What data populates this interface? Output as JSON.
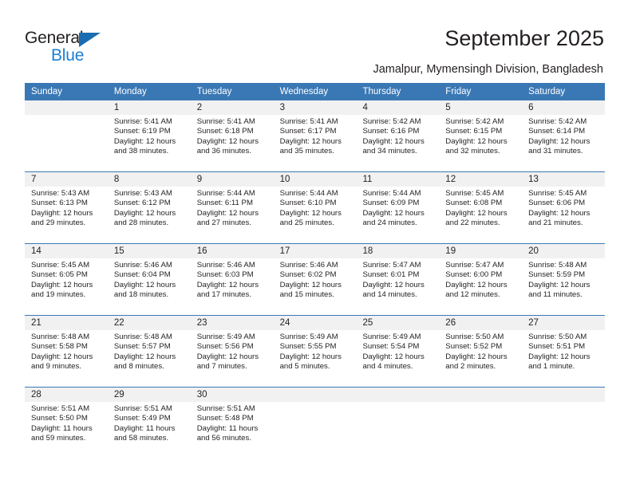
{
  "brand": {
    "name_part1": "General",
    "name_part2": "Blue",
    "triangle_icon": "triangle-icon",
    "accent_color": "#1b7fd4"
  },
  "header": {
    "month_title": "September 2025",
    "location": "Jamalpur, Mymensingh Division, Bangladesh"
  },
  "theme": {
    "header_blue": "#3a78b5",
    "daynum_gray": "#f1f1f1",
    "text_color": "#231f20"
  },
  "calendar": {
    "weekday_headers": [
      "Sunday",
      "Monday",
      "Tuesday",
      "Wednesday",
      "Thursday",
      "Friday",
      "Saturday"
    ],
    "weeks": [
      {
        "days": [
          {
            "num": "",
            "sunrise": "",
            "sunset": "",
            "daylight": ""
          },
          {
            "num": "1",
            "sunrise": "Sunrise: 5:41 AM",
            "sunset": "Sunset: 6:19 PM",
            "daylight": "Daylight: 12 hours and 38 minutes."
          },
          {
            "num": "2",
            "sunrise": "Sunrise: 5:41 AM",
            "sunset": "Sunset: 6:18 PM",
            "daylight": "Daylight: 12 hours and 36 minutes."
          },
          {
            "num": "3",
            "sunrise": "Sunrise: 5:41 AM",
            "sunset": "Sunset: 6:17 PM",
            "daylight": "Daylight: 12 hours and 35 minutes."
          },
          {
            "num": "4",
            "sunrise": "Sunrise: 5:42 AM",
            "sunset": "Sunset: 6:16 PM",
            "daylight": "Daylight: 12 hours and 34 minutes."
          },
          {
            "num": "5",
            "sunrise": "Sunrise: 5:42 AM",
            "sunset": "Sunset: 6:15 PM",
            "daylight": "Daylight: 12 hours and 32 minutes."
          },
          {
            "num": "6",
            "sunrise": "Sunrise: 5:42 AM",
            "sunset": "Sunset: 6:14 PM",
            "daylight": "Daylight: 12 hours and 31 minutes."
          }
        ]
      },
      {
        "days": [
          {
            "num": "7",
            "sunrise": "Sunrise: 5:43 AM",
            "sunset": "Sunset: 6:13 PM",
            "daylight": "Daylight: 12 hours and 29 minutes."
          },
          {
            "num": "8",
            "sunrise": "Sunrise: 5:43 AM",
            "sunset": "Sunset: 6:12 PM",
            "daylight": "Daylight: 12 hours and 28 minutes."
          },
          {
            "num": "9",
            "sunrise": "Sunrise: 5:44 AM",
            "sunset": "Sunset: 6:11 PM",
            "daylight": "Daylight: 12 hours and 27 minutes."
          },
          {
            "num": "10",
            "sunrise": "Sunrise: 5:44 AM",
            "sunset": "Sunset: 6:10 PM",
            "daylight": "Daylight: 12 hours and 25 minutes."
          },
          {
            "num": "11",
            "sunrise": "Sunrise: 5:44 AM",
            "sunset": "Sunset: 6:09 PM",
            "daylight": "Daylight: 12 hours and 24 minutes."
          },
          {
            "num": "12",
            "sunrise": "Sunrise: 5:45 AM",
            "sunset": "Sunset: 6:08 PM",
            "daylight": "Daylight: 12 hours and 22 minutes."
          },
          {
            "num": "13",
            "sunrise": "Sunrise: 5:45 AM",
            "sunset": "Sunset: 6:06 PM",
            "daylight": "Daylight: 12 hours and 21 minutes."
          }
        ]
      },
      {
        "days": [
          {
            "num": "14",
            "sunrise": "Sunrise: 5:45 AM",
            "sunset": "Sunset: 6:05 PM",
            "daylight": "Daylight: 12 hours and 19 minutes."
          },
          {
            "num": "15",
            "sunrise": "Sunrise: 5:46 AM",
            "sunset": "Sunset: 6:04 PM",
            "daylight": "Daylight: 12 hours and 18 minutes."
          },
          {
            "num": "16",
            "sunrise": "Sunrise: 5:46 AM",
            "sunset": "Sunset: 6:03 PM",
            "daylight": "Daylight: 12 hours and 17 minutes."
          },
          {
            "num": "17",
            "sunrise": "Sunrise: 5:46 AM",
            "sunset": "Sunset: 6:02 PM",
            "daylight": "Daylight: 12 hours and 15 minutes."
          },
          {
            "num": "18",
            "sunrise": "Sunrise: 5:47 AM",
            "sunset": "Sunset: 6:01 PM",
            "daylight": "Daylight: 12 hours and 14 minutes."
          },
          {
            "num": "19",
            "sunrise": "Sunrise: 5:47 AM",
            "sunset": "Sunset: 6:00 PM",
            "daylight": "Daylight: 12 hours and 12 minutes."
          },
          {
            "num": "20",
            "sunrise": "Sunrise: 5:48 AM",
            "sunset": "Sunset: 5:59 PM",
            "daylight": "Daylight: 12 hours and 11 minutes."
          }
        ]
      },
      {
        "days": [
          {
            "num": "21",
            "sunrise": "Sunrise: 5:48 AM",
            "sunset": "Sunset: 5:58 PM",
            "daylight": "Daylight: 12 hours and 9 minutes."
          },
          {
            "num": "22",
            "sunrise": "Sunrise: 5:48 AM",
            "sunset": "Sunset: 5:57 PM",
            "daylight": "Daylight: 12 hours and 8 minutes."
          },
          {
            "num": "23",
            "sunrise": "Sunrise: 5:49 AM",
            "sunset": "Sunset: 5:56 PM",
            "daylight": "Daylight: 12 hours and 7 minutes."
          },
          {
            "num": "24",
            "sunrise": "Sunrise: 5:49 AM",
            "sunset": "Sunset: 5:55 PM",
            "daylight": "Daylight: 12 hours and 5 minutes."
          },
          {
            "num": "25",
            "sunrise": "Sunrise: 5:49 AM",
            "sunset": "Sunset: 5:54 PM",
            "daylight": "Daylight: 12 hours and 4 minutes."
          },
          {
            "num": "26",
            "sunrise": "Sunrise: 5:50 AM",
            "sunset": "Sunset: 5:52 PM",
            "daylight": "Daylight: 12 hours and 2 minutes."
          },
          {
            "num": "27",
            "sunrise": "Sunrise: 5:50 AM",
            "sunset": "Sunset: 5:51 PM",
            "daylight": "Daylight: 12 hours and 1 minute."
          }
        ]
      },
      {
        "days": [
          {
            "num": "28",
            "sunrise": "Sunrise: 5:51 AM",
            "sunset": "Sunset: 5:50 PM",
            "daylight": "Daylight: 11 hours and 59 minutes."
          },
          {
            "num": "29",
            "sunrise": "Sunrise: 5:51 AM",
            "sunset": "Sunset: 5:49 PM",
            "daylight": "Daylight: 11 hours and 58 minutes."
          },
          {
            "num": "30",
            "sunrise": "Sunrise: 5:51 AM",
            "sunset": "Sunset: 5:48 PM",
            "daylight": "Daylight: 11 hours and 56 minutes."
          },
          {
            "num": "",
            "sunrise": "",
            "sunset": "",
            "daylight": ""
          },
          {
            "num": "",
            "sunrise": "",
            "sunset": "",
            "daylight": ""
          },
          {
            "num": "",
            "sunrise": "",
            "sunset": "",
            "daylight": ""
          },
          {
            "num": "",
            "sunrise": "",
            "sunset": "",
            "daylight": ""
          }
        ]
      }
    ]
  }
}
